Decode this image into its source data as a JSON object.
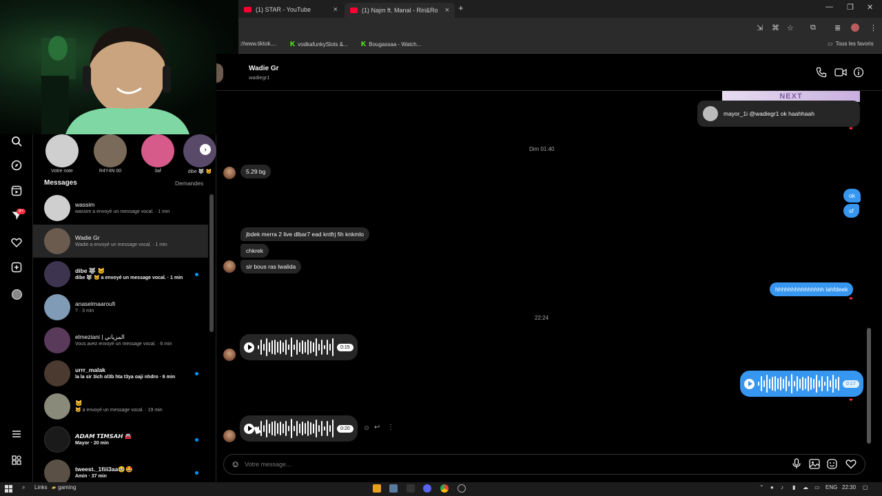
{
  "browser": {
    "tabs": [
      {
        "title": "(1) STAR - YouTube"
      },
      {
        "title": "(1) Najm ft. Manal - Riri&Rocky"
      }
    ],
    "new_tab": "+",
    "bookmarks": [
      {
        "label": "://www.tiktok...."
      },
      {
        "label": "vodkafunkySlots &..."
      },
      {
        "label": "Bougassaa - Watch..."
      }
    ],
    "all_bookmarks": "Tous les favoris"
  },
  "rail": {
    "icons": [
      "search-icon",
      "explore-icon",
      "reels-icon",
      "messages-icon",
      "notifications-icon",
      "create-icon",
      "profile-icon",
      "menu-icon",
      "threads-icon"
    ],
    "badge": "9+"
  },
  "notes": [
    {
      "label": "Votre note",
      "color": "#cfcfcf"
    },
    {
      "label": "R4Y4N 00",
      "color": "#7a6a5a"
    },
    {
      "label": "3af",
      "color": "#d65a8a"
    },
    {
      "label": "dibe 🐺 🐱",
      "color": "#5a4a6a"
    }
  ],
  "messages": {
    "title": "Messages",
    "requests": "Demandes",
    "conversations": [
      {
        "name": "wassim",
        "preview": "wassim a envoyé un message vocal. · 1 min",
        "unread": false,
        "avatar": "#cfcfcf"
      },
      {
        "name": "Wadie Gr",
        "preview": "Wadie a envoyé un message vocal. · 1 min",
        "unread": false,
        "avatar": "#6b5a4e"
      },
      {
        "name": "dibe 🐺 🐱",
        "preview": "dibe 🐺 🐱 a envoyé un message vocal. · 1 min",
        "unread": true,
        "avatar": "#3d3550"
      },
      {
        "name": "anaselmaaroufi",
        "preview": "? · 3 min",
        "unread": false,
        "avatar": "#7f9bb5"
      },
      {
        "name": "elmeziani | المزياني",
        "preview": "Vous avez envoyé un message vocal. · 6 min",
        "unread": false,
        "avatar": "#5a3a5a"
      },
      {
        "name": "urrr_malak",
        "preview": "la la sir 3ich ol3b hta t3ya oaji nhdro · 6 min",
        "unread": true,
        "avatar": "#4a3a30"
      },
      {
        "name": "🐱",
        "preview": "🐱 a envoyé un message vocal. · 19 min",
        "unread": false,
        "avatar": "#8a8a7a"
      },
      {
        "name": "𝘼𝘿𝘼𝙈 𝙏𝙄𝙈𝙎𝘼𝙃 🚘",
        "preview": "Mayor · 20 min",
        "unread": true,
        "avatar": "#1a1a1a"
      },
      {
        "name": "tweest._1fiii3aa🥹🤩",
        "preview": "Amin · 37 min",
        "unread": true,
        "avatar": "#5a5045"
      }
    ]
  },
  "chat": {
    "name": "Wadie Gr",
    "username": "wadiegr1",
    "story_reply": "mayor_1i @wadiegr1 ok haahhaah",
    "story_banner": "NEXT",
    "ts1": "Dim 01:40",
    "ts2": "22:24",
    "msgs": {
      "m1": "5.29 bg",
      "r1": "ok",
      "r2": "sf",
      "m2": "jbdek merra 2 live dlbar7 ead kntfrj fih knkmlo",
      "m3": "chkrek",
      "m4": "sir  bous ras lwalida",
      "r3": "hhhhhhhhhhhhhhh lahfdeek"
    },
    "voice1": "0:15",
    "voice2": "0:17",
    "voice3": "0:20",
    "composer_placeholder": "Votre message..."
  },
  "taskbar": {
    "links": "Links",
    "folder": "gaming",
    "lang": "ENG",
    "time": "22:30"
  }
}
